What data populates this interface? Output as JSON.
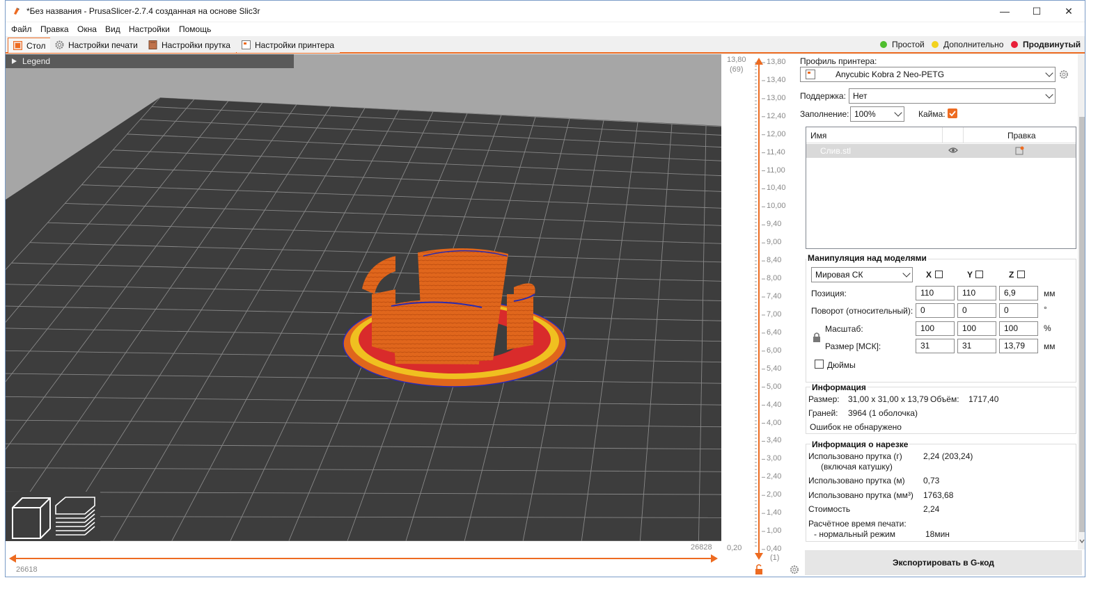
{
  "window": {
    "title": "*Без названия - PrusaSlicer-2.7.4 созданная на основе Slic3r",
    "minimize": "—",
    "maximize": "☐",
    "close": "✕"
  },
  "menu": [
    "Файл",
    "Правка",
    "Окна",
    "Вид",
    "Настройки",
    "Помощь"
  ],
  "tabs": [
    {
      "label": "Стол",
      "icon": "plater-icon",
      "active": true
    },
    {
      "label": "Настройки печати",
      "icon": "cog-icon",
      "active": false
    },
    {
      "label": "Настройки прутка",
      "icon": "spool-icon",
      "active": false
    },
    {
      "label": "Настройки принтера",
      "icon": "printer-icon",
      "active": false
    }
  ],
  "modes": [
    {
      "label": "Простой",
      "color": "#4fbe2e",
      "bold": false
    },
    {
      "label": "Дополнительно",
      "color": "#f2d21e",
      "bold": false
    },
    {
      "label": "Продвинутый",
      "color": "#e8203a",
      "bold": true
    }
  ],
  "viewport": {
    "legend_label": "Legend",
    "bed_color": "#3d3d3d",
    "background_color": "#a6a6a6",
    "model_color": "#e0661c"
  },
  "hslider": {
    "left_value": "26618",
    "right_value": "26828",
    "color": "#ed6b21"
  },
  "vslider": {
    "top_left": "13,80",
    "top_left_sub": "(69)",
    "bottom_left": "0,20",
    "bottom_left_sub": "(1)",
    "ticks": [
      "13,80",
      "13,40",
      "13,00",
      "12,40",
      "12,00",
      "11,40",
      "11,00",
      "10,40",
      "10,00",
      "9,40",
      "9,00",
      "8,40",
      "8,00",
      "7,40",
      "7,00",
      "6,40",
      "6,00",
      "5,40",
      "5,00",
      "4,40",
      "4,00",
      "3,40",
      "3,00",
      "2,40",
      "2,00",
      "1,40",
      "1,00",
      "0,40"
    ]
  },
  "sidebar": {
    "printer_profile_label": "Профиль принтера:",
    "printer_profile_value": "Anycubic Kobra 2 Neo-PETG",
    "support_label": "Поддержка:",
    "support_value": "Нет",
    "infill_label": "Заполнение:",
    "infill_value": "100%",
    "brim_label": "Кайма:",
    "brim_checked": true,
    "objects_header_name": "Имя",
    "objects_header_edit": "Правка",
    "objects": [
      {
        "name": "Слив.stl"
      }
    ],
    "manipulation": {
      "title": "Манипуляция над моделями",
      "coord_system": "Мировая СК",
      "axes": [
        "X",
        "Y",
        "Z"
      ],
      "position_label": "Позиция:",
      "position": [
        "110",
        "110",
        "6,9"
      ],
      "position_unit": "мм",
      "rotation_label": "Поворот (относительный):",
      "rotation": [
        "0",
        "0",
        "0"
      ],
      "rotation_unit": "°",
      "scale_label": "Масштаб:",
      "scale": [
        "100",
        "100",
        "100"
      ],
      "scale_unit": "%",
      "size_label": "Размер [МСК]:",
      "size": [
        "31",
        "31",
        "13,79"
      ],
      "size_unit": "мм",
      "inches_label": "Дюймы"
    },
    "info": {
      "title": "Информация",
      "size_label": "Размер:",
      "size_value": "31,00 x 31,00 x 13,79",
      "volume_label": "Объём:",
      "volume_value": "1717,40",
      "facets_label": "Граней:",
      "facets_value": "3964 (1 оболочка)",
      "errors": "Ошибок не обнаружено"
    },
    "slice_info": {
      "title": "Информация о нарезке",
      "used_g_label": "Использовано прутка (г)",
      "used_g_sub": "(включая катушку)",
      "used_g_value": "2,24 (203,24)",
      "used_m_label": "Использовано прутка (м)",
      "used_m_value": "0,73",
      "used_mm3_label": "Использовано прутка (мм³)",
      "used_mm3_value": "1763,68",
      "cost_label": "Стоимость",
      "cost_value": "2,24",
      "time_label": "Расчётное время печати:",
      "time_mode": "- нормальный режим",
      "time_value": "18мин"
    },
    "export_button": "Экспортировать в G-код"
  }
}
